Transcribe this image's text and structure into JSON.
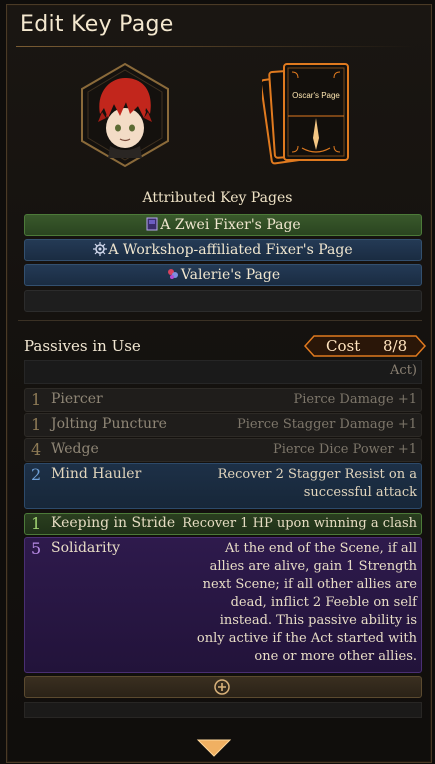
{
  "window": {
    "title": "Edit Key Page"
  },
  "key_page_card": {
    "title": "Oscar's Page"
  },
  "attributed": {
    "label": "Attributed Key Pages",
    "items": [
      {
        "label": "A Zwei Fixer's Page",
        "color": "#39592b"
      },
      {
        "label": "A Workshop-affiliated Fixer's Page",
        "color": "#243a55"
      },
      {
        "label": "Valerie's Page",
        "color": "#243a55"
      }
    ]
  },
  "passives": {
    "label": "Passives in Use",
    "cost_label": "Cost",
    "cost_value": "8/8",
    "act_fragment": "Act)",
    "items": [
      {
        "cost": "1",
        "name": "Piercer",
        "desc": "Pierce Damage +1"
      },
      {
        "cost": "1",
        "name": "Jolting Puncture",
        "desc": "Pierce Stagger Damage +1"
      },
      {
        "cost": "4",
        "name": "Wedge",
        "desc": "Pierce Dice Power +1"
      },
      {
        "cost": "2",
        "name": "Mind Hauler",
        "desc": "Recover 2 Stagger Resist on a successful attack"
      },
      {
        "cost": "1",
        "name": "Keeping in Stride",
        "desc": "Recover 1 HP upon winning a clash"
      },
      {
        "cost": "5",
        "name": "Solidarity",
        "desc": "At the end of the Scene, if all allies are alive, gain 1 Strength next Scene; if all other allies are dead, inflict 2 Feeble on self instead. This passive ability is only active if the Act started with one or more other allies."
      }
    ]
  },
  "colors": {
    "accent": "#e07a1f",
    "gold": "#c8913f"
  },
  "icons": {
    "add": "plus-circle-icon",
    "scroll_down": "chevron-down-icon"
  }
}
